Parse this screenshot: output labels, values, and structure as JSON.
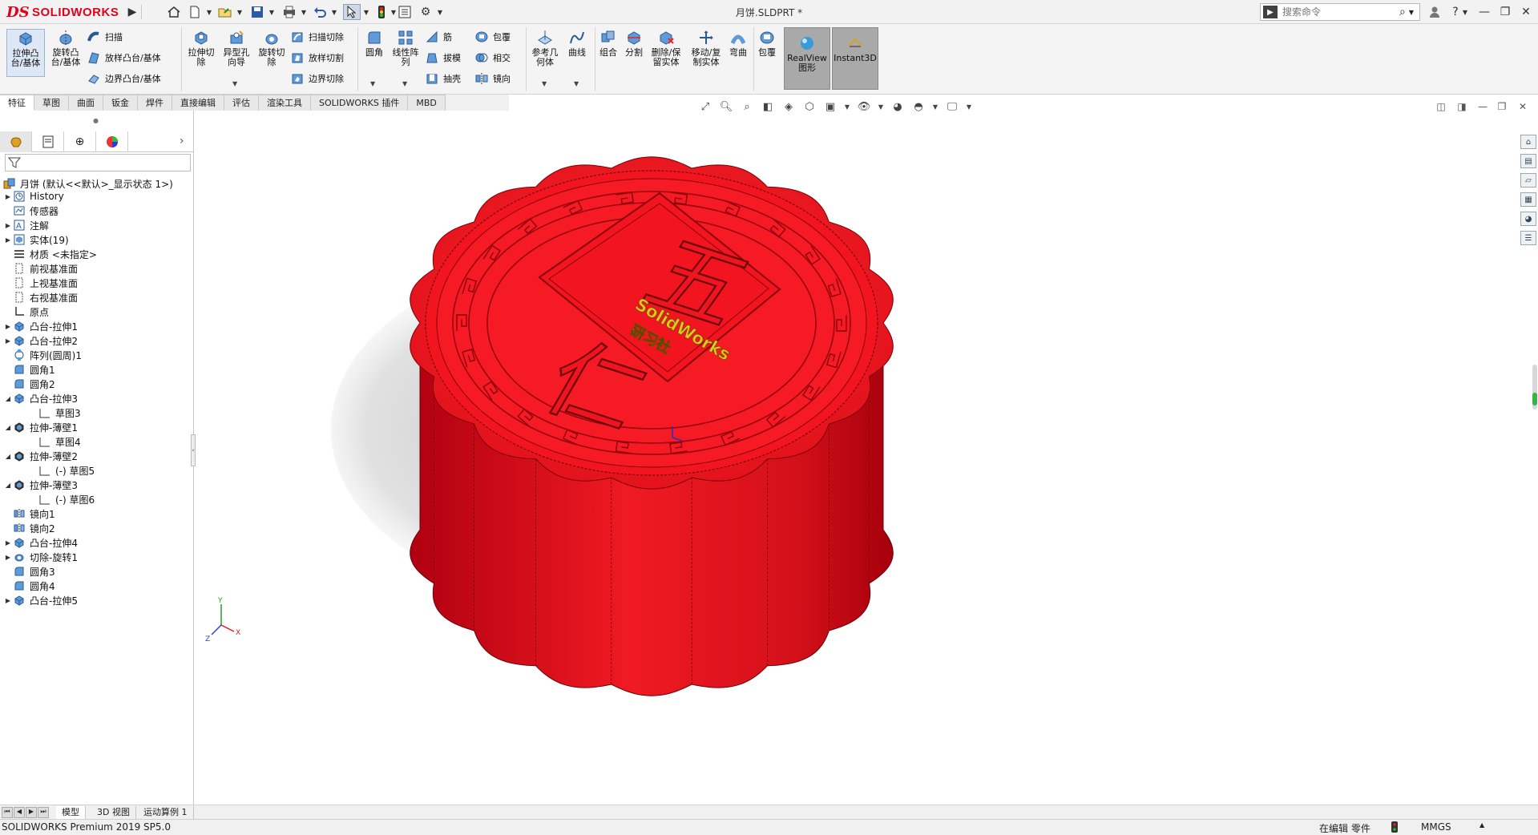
{
  "titlebar": {
    "brand_solid": "SOLID",
    "brand_works": "WORKS",
    "document_title": "月饼.SLDPRT *",
    "search_placeholder": "搜索命令"
  },
  "ribbon": {
    "extrude_boss": "拉伸凸\n台/基体",
    "revolve_boss": "旋转凸\n台/基体",
    "sweep": "扫描",
    "loft_boss": "放样凸台/基体",
    "boundary_boss": "边界凸台/基体",
    "extrude_cut": "拉伸切\n除",
    "hole_wizard": "异型孔\n向导",
    "revolve_cut": "旋转切\n除",
    "sweep_cut": "扫描切除",
    "loft_cut": "放样切割",
    "boundary_cut": "边界切除",
    "fillet": "圆角",
    "linear_pattern": "线性阵\n列",
    "rib": "筋",
    "draft": "拔模",
    "shell": "抽壳",
    "wrap": "包覆",
    "intersect": "相交",
    "mirror": "镜向",
    "ref_geometry": "参考几\n何体",
    "curves": "曲线",
    "combine": "组合",
    "split": "分割",
    "delete_keep_body": "删除/保\n留实体",
    "move_copy_body": "移动/复\n制实体",
    "flex": "弯曲",
    "wrap2": "包覆",
    "realview": "RealView\n图形",
    "instant3d": "Instant3D"
  },
  "tabs": [
    "特征",
    "草图",
    "曲面",
    "钣金",
    "焊件",
    "直接编辑",
    "评估",
    "渲染工具",
    "SOLIDWORKS 插件",
    "MBD"
  ],
  "tree": {
    "root": "月饼  (默认<<默认>_显示状态 1>)",
    "items": [
      {
        "label": "History",
        "icon": "history-icon",
        "expand": true,
        "indent": 0
      },
      {
        "label": "传感器",
        "icon": "sensor-icon",
        "expand": false,
        "indent": 0
      },
      {
        "label": "注解",
        "icon": "annotation-icon",
        "expand": true,
        "indent": 0
      },
      {
        "label": "实体(19)",
        "icon": "solid-bodies-icon",
        "expand": true,
        "indent": 0
      },
      {
        "label": "材质 <未指定>",
        "icon": "material-icon",
        "expand": false,
        "indent": 0
      },
      {
        "label": "前视基准面",
        "icon": "plane-icon",
        "expand": false,
        "indent": 0
      },
      {
        "label": "上视基准面",
        "icon": "plane-icon",
        "expand": false,
        "indent": 0
      },
      {
        "label": "右视基准面",
        "icon": "plane-icon",
        "expand": false,
        "indent": 0
      },
      {
        "label": "原点",
        "icon": "origin-icon",
        "expand": false,
        "indent": 0
      },
      {
        "label": "凸台-拉伸1",
        "icon": "extrude-icon",
        "expand": true,
        "indent": 0
      },
      {
        "label": "凸台-拉伸2",
        "icon": "extrude-icon",
        "expand": true,
        "indent": 0
      },
      {
        "label": "阵列(圆周)1",
        "icon": "circular-pattern-icon",
        "expand": false,
        "indent": 0
      },
      {
        "label": "圆角1",
        "icon": "fillet-icon",
        "expand": false,
        "indent": 0
      },
      {
        "label": "圆角2",
        "icon": "fillet-icon",
        "expand": false,
        "indent": 0
      },
      {
        "label": "凸台-拉伸3",
        "icon": "extrude-icon",
        "expand": "open",
        "indent": 0
      },
      {
        "label": "草图3",
        "icon": "sketch-icon",
        "expand": false,
        "indent": 1
      },
      {
        "label": "拉伸-薄壁1",
        "icon": "thin-extrude-icon",
        "expand": "open",
        "indent": 0
      },
      {
        "label": "草图4",
        "icon": "sketch-icon",
        "expand": false,
        "indent": 1
      },
      {
        "label": "拉伸-薄壁2",
        "icon": "thin-extrude-icon",
        "expand": "open",
        "indent": 0
      },
      {
        "label": "(-) 草图5",
        "icon": "sketch-icon",
        "expand": false,
        "indent": 1
      },
      {
        "label": "拉伸-薄壁3",
        "icon": "thin-extrude-icon",
        "expand": "open",
        "indent": 0
      },
      {
        "label": "(-) 草图6",
        "icon": "sketch-icon",
        "expand": false,
        "indent": 1
      },
      {
        "label": "镜向1",
        "icon": "mirror-icon",
        "expand": false,
        "indent": 0
      },
      {
        "label": "镜向2",
        "icon": "mirror-icon",
        "expand": false,
        "indent": 0
      },
      {
        "label": "凸台-拉伸4",
        "icon": "extrude-icon",
        "expand": true,
        "indent": 0
      },
      {
        "label": "切除-旋转1",
        "icon": "revolve-cut-icon",
        "expand": true,
        "indent": 0
      },
      {
        "label": "圆角3",
        "icon": "fillet-icon",
        "expand": false,
        "indent": 0
      },
      {
        "label": "圆角4",
        "icon": "fillet-icon",
        "expand": false,
        "indent": 0
      },
      {
        "label": "凸台-拉伸5",
        "icon": "extrude-icon",
        "expand": true,
        "indent": 0
      }
    ]
  },
  "model": {
    "char_top": "五",
    "char_bottom": "仁",
    "emboss_brand": "SolidWorks",
    "emboss_sub": "研习社",
    "color_body": "#e8101c",
    "color_text": "#e6c21a"
  },
  "bottom_tabs": [
    "模型",
    "3D 视图",
    "运动算例 1"
  ],
  "status": {
    "version": "SOLIDWORKS Premium 2019 SP5.0",
    "mode": "在编辑 零件",
    "units": "MMGS"
  }
}
